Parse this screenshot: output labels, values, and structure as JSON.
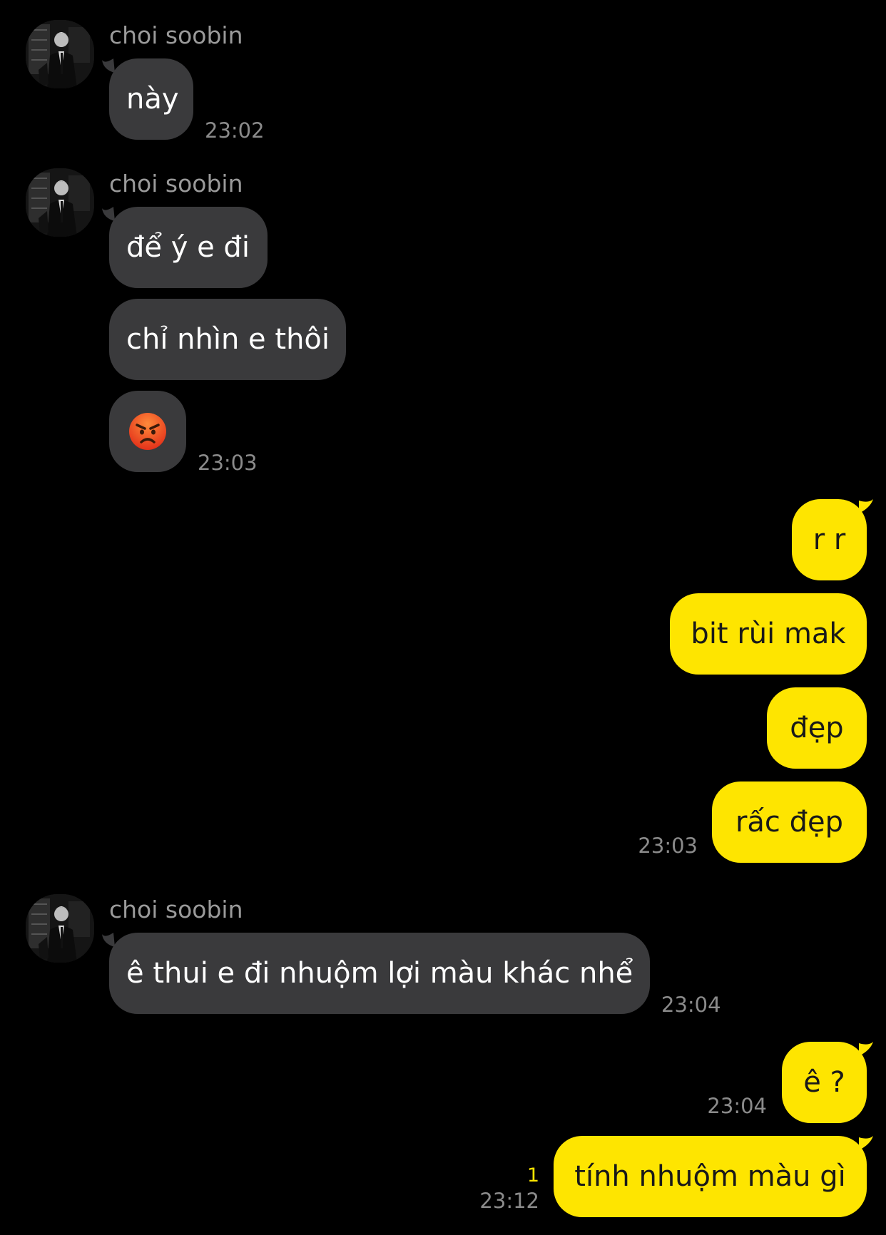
{
  "chat": {
    "contact_name": "choi soobin",
    "colors": {
      "background": "#000000",
      "incoming_bubble": "#3a3a3c",
      "outgoing_bubble": "#fee500",
      "timestamp": "#8b8b8b",
      "unread_count": "#fee500"
    },
    "groups": [
      {
        "sender": "choi soobin",
        "direction": "incoming",
        "messages": [
          {
            "text": "này"
          }
        ],
        "time": "23:02"
      },
      {
        "sender": "choi soobin",
        "direction": "incoming",
        "messages": [
          {
            "text": "để ý e đi"
          },
          {
            "text": "chỉ nhìn e thôi"
          },
          {
            "emoji": "angry-face-icon"
          }
        ],
        "time": "23:03"
      },
      {
        "direction": "outgoing",
        "messages": [
          {
            "text": "r r"
          },
          {
            "text": "bit rùi mak"
          },
          {
            "text": "đẹp"
          },
          {
            "text": "rấc đẹp"
          }
        ],
        "time": "23:03"
      },
      {
        "sender": "choi soobin",
        "direction": "incoming",
        "messages": [
          {
            "text": "ê thui e đi nhuộm lợi màu khác nhể"
          }
        ],
        "time": "23:04"
      },
      {
        "direction": "outgoing",
        "messages": [
          {
            "text": "ê ?"
          }
        ],
        "time": "23:04"
      },
      {
        "direction": "outgoing",
        "messages": [
          {
            "text": "tính nhuộm màu gì"
          }
        ],
        "time": "23:12",
        "unread_count": "1"
      }
    ]
  }
}
